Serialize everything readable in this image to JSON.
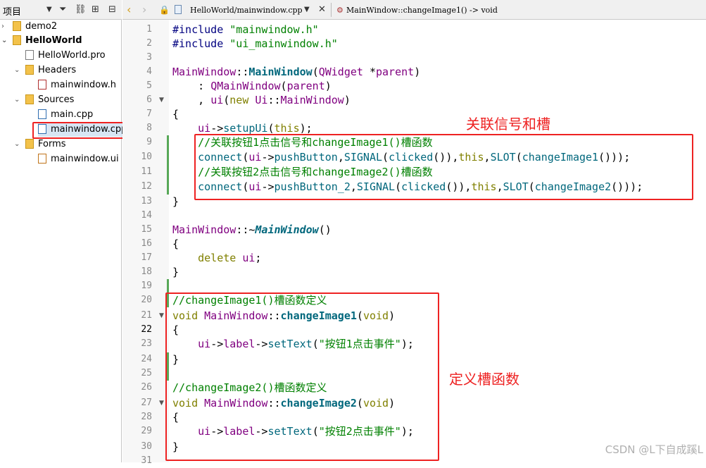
{
  "project_panel": {
    "title": "项目",
    "tree": [
      {
        "label": "demo2",
        "bold": false
      },
      {
        "label": "HelloWorld",
        "bold": true
      },
      {
        "label": "HelloWorld.pro",
        "bold": false
      },
      {
        "label": "Headers",
        "bold": false
      },
      {
        "label": "mainwindow.h",
        "bold": false
      },
      {
        "label": "Sources",
        "bold": false
      },
      {
        "label": "main.cpp",
        "bold": false
      },
      {
        "label": "mainwindow.cpp",
        "bold": false,
        "selected": true
      },
      {
        "label": "Forms",
        "bold": false
      },
      {
        "label": "mainwindow.ui",
        "bold": false
      }
    ]
  },
  "editor_toolbar": {
    "file_path": "HelloWorld/mainwindow.cpp",
    "symbol": "MainWindow::changeImage1() -> void"
  },
  "editor": {
    "line_numbers": [
      "1",
      "2",
      "3",
      "4",
      "5",
      "6",
      "7",
      "8",
      "9",
      "10",
      "11",
      "12",
      "13",
      "14",
      "15",
      "16",
      "17",
      "18",
      "19",
      "20",
      "21",
      "22",
      "23",
      "24",
      "25",
      "26",
      "27",
      "28",
      "29",
      "30",
      "31"
    ],
    "current_line": "22"
  },
  "annotations": {
    "signal_slot": "关联信号和槽",
    "define_slot": "定义槽函数"
  },
  "code": {
    "l1": [
      "#include ",
      "\"mainwindow.h\""
    ],
    "l2": [
      "#include ",
      "\"ui_mainwindow.h\""
    ],
    "l4": [
      "MainWindow",
      "::",
      "MainWindow",
      "(",
      "QWidget",
      " *",
      "parent",
      ")"
    ],
    "l5": [
      "    : ",
      "QMainWindow",
      "(",
      "parent",
      ")"
    ],
    "l6": [
      "    , ",
      "ui",
      "(",
      "new",
      " ",
      "Ui",
      "::",
      "MainWindow",
      ")"
    ],
    "l7": "{",
    "l8": [
      "    ",
      "ui",
      "->",
      "setupUi",
      "(",
      "this",
      ");"
    ],
    "l9": "    //关联按钮1点击信号和changeImage1()槽函数",
    "l10": [
      "    ",
      "connect",
      "(",
      "ui",
      "->",
      "pushButton",
      ",",
      "SIGNAL",
      "(",
      "clicked",
      "()),",
      "this",
      ",",
      "SLOT",
      "(",
      "changeImage1",
      "()));"
    ],
    "l11": "    //关联按钮2点击信号和changeImage2()槽函数",
    "l12": [
      "    ",
      "connect",
      "(",
      "ui",
      "->",
      "pushButton_2",
      ",",
      "SIGNAL",
      "(",
      "clicked",
      "()),",
      "this",
      ",",
      "SLOT",
      "(",
      "changeImage2",
      "()));"
    ],
    "l13": "}",
    "l15": [
      "MainWindow",
      "::~",
      "MainWindow",
      "()"
    ],
    "l16": "{",
    "l17": [
      "    ",
      "delete",
      " ",
      "ui",
      ";"
    ],
    "l18": "}",
    "l20": "//changeImage1()槽函数定义",
    "l21": [
      "void",
      " ",
      "MainWindow",
      "::",
      "changeImage1",
      "(",
      "void",
      ")"
    ],
    "l22": "{",
    "l23": [
      "    ",
      "ui",
      "->",
      "label",
      "->",
      "setText",
      "(",
      "\"按钮1点击事件\"",
      ");"
    ],
    "l24": "}",
    "l26": "//changeImage2()槽函数定义",
    "l27": [
      "void",
      " ",
      "MainWindow",
      "::",
      "changeImage2",
      "(",
      "void",
      ")"
    ],
    "l28": "{",
    "l29": [
      "    ",
      "ui",
      "->",
      "label",
      "->",
      "setText",
      "(",
      "\"按钮2点击事件\"",
      ");"
    ],
    "l30": "}"
  },
  "watermark": "CSDN @L下自成蹊L",
  "colors": {
    "annotation_red": "#ee2222",
    "keyword": "#808000",
    "type": "#800080",
    "function": "#00677c",
    "string_comment": "#008000"
  }
}
